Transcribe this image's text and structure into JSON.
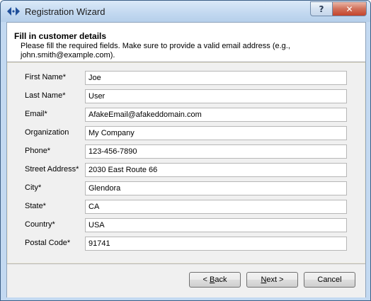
{
  "window": {
    "title": "Registration Wizard",
    "help_label": "?",
    "close_label": "✕"
  },
  "header": {
    "title": "Fill in customer details",
    "subtitle": "Please fill the required fields.  Make sure to provide a valid email address (e.g., john.smith@example.com)."
  },
  "form": {
    "fields": [
      {
        "label": "First Name*",
        "value": "Joe"
      },
      {
        "label": "Last Name*",
        "value": "User"
      },
      {
        "label": "Email*",
        "value": "AfakeEmail@afakeddomain.com"
      },
      {
        "label": "Organization",
        "value": "My Company"
      },
      {
        "label": "Phone*",
        "value": "123-456-7890"
      },
      {
        "label": "Street Address*",
        "value": "2030 East Route 66"
      },
      {
        "label": "City*",
        "value": "Glendora"
      },
      {
        "label": "State*",
        "value": "CA"
      },
      {
        "label": "Country*",
        "value": "USA"
      },
      {
        "label": "Postal Code*",
        "value": "91741"
      }
    ]
  },
  "buttons": {
    "back_prefix": "< ",
    "back_mnemonic": "B",
    "back_rest": "ack",
    "next_mnemonic": "N",
    "next_rest": "ext >",
    "cancel_label": "Cancel"
  },
  "icons": {
    "title_icon": "wizard-arrows-icon"
  }
}
